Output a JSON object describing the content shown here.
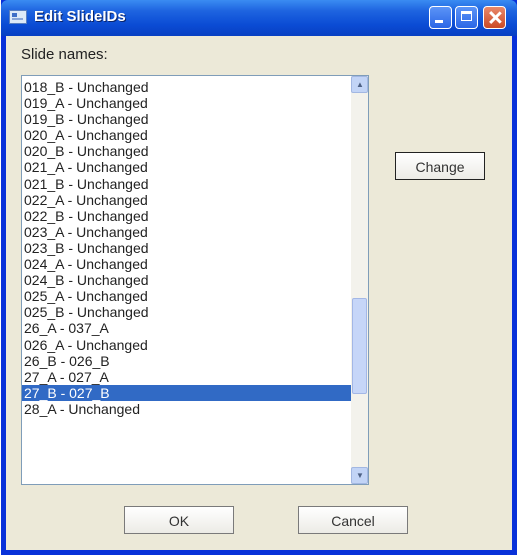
{
  "window": {
    "title": "Edit SlideIDs"
  },
  "label": "Slide names:",
  "list": {
    "items": [
      "018_B - Unchanged",
      "019_A - Unchanged",
      "019_B - Unchanged",
      "020_A - Unchanged",
      "020_B - Unchanged",
      "021_A - Unchanged",
      "021_B - Unchanged",
      "022_A - Unchanged",
      "022_B - Unchanged",
      "023_A - Unchanged",
      "023_B - Unchanged",
      "024_A - Unchanged",
      "024_B - Unchanged",
      "025_A - Unchanged",
      "025_B - Unchanged",
      "26_A - 037_A",
      "026_A - Unchanged",
      "26_B - 026_B",
      "27_A - 027_A",
      "27_B - 027_B",
      "28_A - Unchanged"
    ],
    "selected_index": 19
  },
  "buttons": {
    "change": "Change",
    "ok": "OK",
    "cancel": "Cancel"
  },
  "colors": {
    "titlebar": "#0a4bd4",
    "selection": "#316ac5",
    "dialog_bg": "#ece9d8"
  },
  "icons": {
    "app": "slides-icon",
    "minimize": "minimize-icon",
    "maximize": "maximize-icon",
    "close": "close-icon"
  }
}
